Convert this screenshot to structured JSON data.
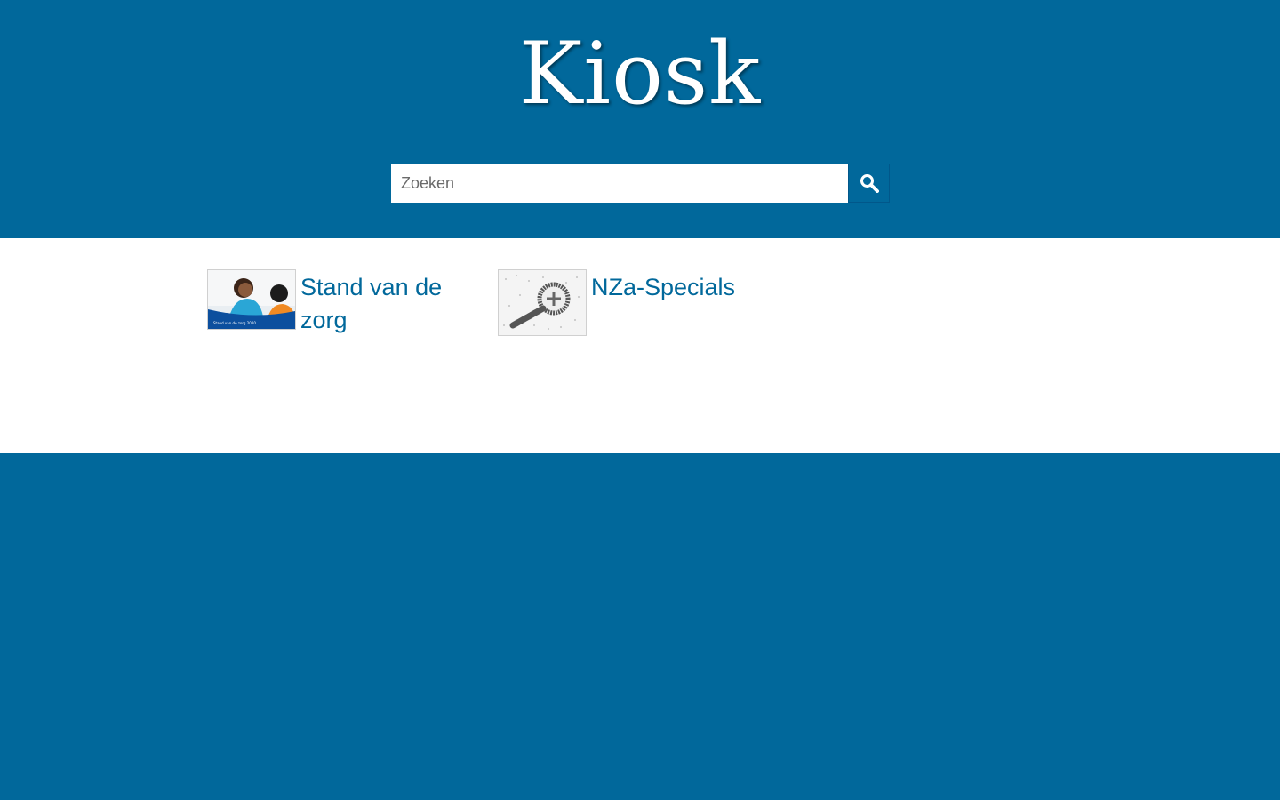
{
  "header": {
    "title": "Kiosk",
    "background_color": "#01689b"
  },
  "search": {
    "placeholder": "Zoeken",
    "value": "",
    "button_icon": "search-icon"
  },
  "tiles": [
    {
      "label": "Stand van de zorg",
      "thumbnail_caption": "Stand van de zorg 2020"
    },
    {
      "label": "NZa-Specials",
      "thumbnail_icon": "magnifier-plus-icon"
    }
  ],
  "colors": {
    "brand": "#01689b",
    "link": "#01689b",
    "content_background": "#ffffff"
  }
}
